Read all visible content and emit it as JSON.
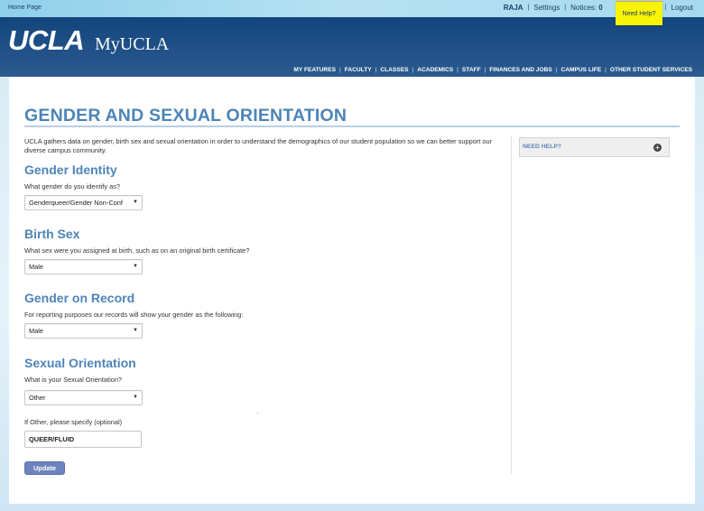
{
  "topbar": {
    "home_link": "Home Page",
    "user": "RAJA",
    "settings": "Settings",
    "notices_label": "Notices:",
    "notices_count": "0",
    "logout": "Logout",
    "need_help_tip": "Need Help?"
  },
  "header": {
    "logo_ucla": "UCLA",
    "logo_my": "MyUCLA",
    "nav": [
      "MY FEATURES",
      "FACULTY",
      "CLASSES",
      "ACADEMICS",
      "STAFF",
      "FINANCES AND JOBS",
      "CAMPUS LIFE",
      "OTHER STUDENT SERVICES"
    ]
  },
  "page": {
    "title": "GENDER AND SEXUAL ORIENTATION",
    "intro": "UCLA gathers data on gender, birth sex and sexual orientation in order to understand the demographics of our student population so we can better support our diverse campus community.",
    "sections": {
      "gender_identity": {
        "title": "Gender Identity",
        "question": "What gender do you identify as?",
        "selected": "Genderqueer/Gender Non-Conf"
      },
      "birth_sex": {
        "title": "Birth Sex",
        "question": "What sex were you assigned at birth, such as on an original birth certificate?",
        "selected": "Male"
      },
      "gender_on_record": {
        "title": "Gender on Record",
        "question": "For reporting purposes our records will show your gender as the following:",
        "selected": "Male"
      },
      "sexual_orientation": {
        "title": "Sexual Orientation",
        "question": "What is your Sexual Orientation?",
        "selected": "Other",
        "other_label": "If Other, please specify (optional)",
        "other_value": "QUEER/FLUID"
      }
    },
    "update_button": "Update"
  },
  "sidebar": {
    "need_help": "NEED HELP?",
    "expand_icon": "plus-circle-icon"
  },
  "icons": {
    "caret": "▼",
    "plus": "+"
  }
}
